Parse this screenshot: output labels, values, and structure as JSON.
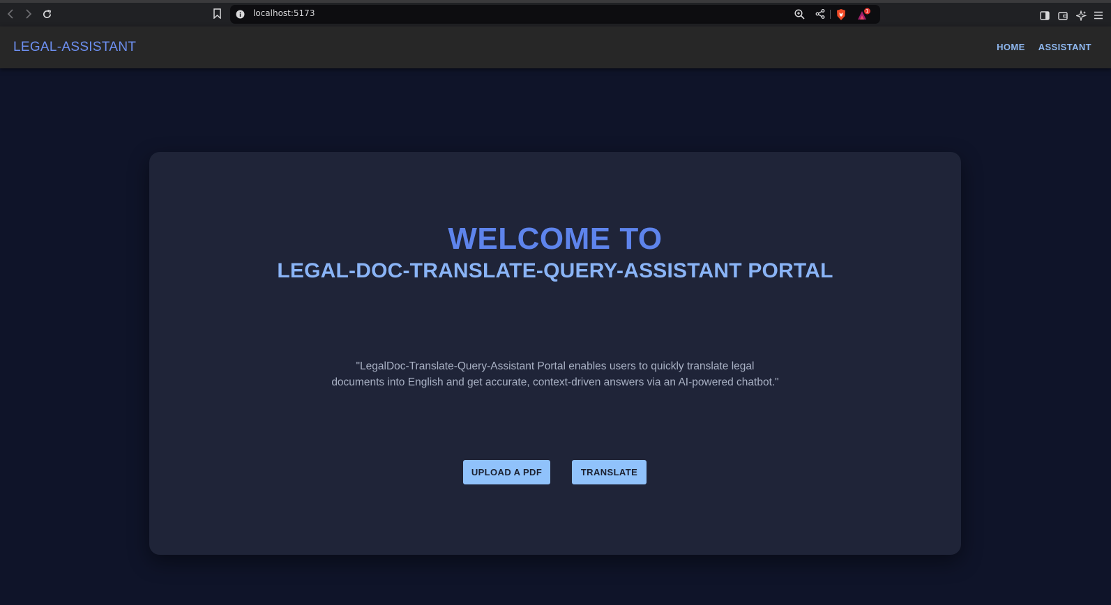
{
  "browser": {
    "url": "localhost:5173",
    "notification_count": "1"
  },
  "header": {
    "brand": "LEGAL-ASSISTANT",
    "nav": [
      {
        "label": "HOME"
      },
      {
        "label": "ASSISTANT"
      }
    ]
  },
  "hero": {
    "title_line1": "WELCOME TO",
    "title_line2": "LEGAL-DOC-TRANSLATE-QUERY-ASSISTANT PORTAL",
    "description": "\"LegalDoc-Translate-Query-Assistant Portal enables users to quickly translate legal documents into English and get accurate, context-driven answers via an AI-powered chatbot.\"",
    "buttons": {
      "upload": "UPLOAD A PDF",
      "translate": "TRANSLATE"
    }
  },
  "colors": {
    "page_bg": "#0f1429",
    "header_bg": "#272727",
    "card_bg": "#1f2438",
    "brand": "#6d8ff0",
    "title_primary": "#5e84ec",
    "title_secondary": "#8ab4f6",
    "button_bg": "#90c2fb"
  },
  "icons": [
    "back-icon",
    "forward-icon",
    "reload-icon",
    "bookmark-icon",
    "site-info-icon",
    "zoom-icon",
    "share-icon",
    "brave-shield-icon",
    "brave-rewards-icon",
    "sidebar-icon",
    "wallet-icon",
    "leo-ai-icon",
    "menu-icon"
  ]
}
